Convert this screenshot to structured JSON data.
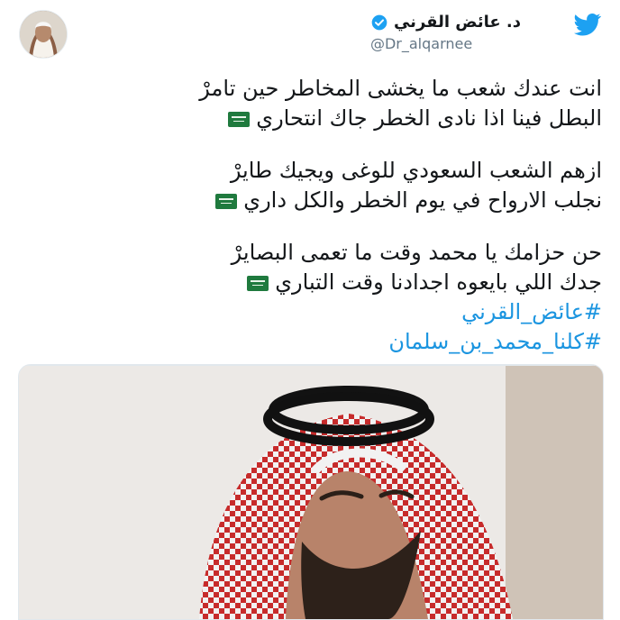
{
  "header": {
    "display_name": "د. عائض القرني",
    "handle": "@Dr_alqarnee",
    "verified": true,
    "brand_color": "#1da1f2"
  },
  "tweet": {
    "lines": [
      "انت عندك شعب ما يخشى المخاطر حين تامرْ",
      "البطل فينا اذا نادى الخطر جاك انتحاري",
      "ازهم الشعب السعودي للوغى ويجيك طايرْ",
      "نجلب الارواح في يوم الخطر والكل داري",
      "حن حزامك يا محمد وقت ما تعمى البصايرْ",
      "جدك اللي بايعوه اجدادنا وقت التباري"
    ],
    "hashtags": [
      "#عائض_القرني",
      "#كلنا_محمد_بن_سلمان"
    ]
  },
  "icons": {
    "logo": "twitter-bird-icon",
    "verified": "verified-badge-icon",
    "flag": "saudi-flag-emoji"
  }
}
